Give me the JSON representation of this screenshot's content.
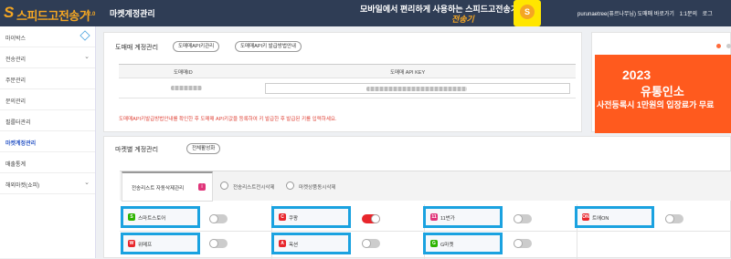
{
  "header": {
    "logo_text": "스피드고전송기",
    "logo_version": "V2.0",
    "page_title": "마켓계정관리",
    "banner_text": "모바일에서 편리하게 사용하는 스피드고전송기!",
    "banner_sub": "전송기",
    "user_links": [
      "purunaetree(퓨르나무님) 도매매 바로가기",
      "1:1문의",
      "로그"
    ]
  },
  "sidebar": {
    "items": [
      {
        "label": "마이박스",
        "has_icon": "cube-icon"
      },
      {
        "label": "전송관리",
        "chevron": "⌄"
      },
      {
        "label": "주문관리"
      },
      {
        "label": "문의관리"
      },
      {
        "label": "필를터관리"
      },
      {
        "label": "마켓계정관리",
        "active": true
      },
      {
        "label": "매출통계"
      },
      {
        "label": "해외마켓(쇼피)",
        "chevron": "⌄"
      }
    ]
  },
  "wholesale": {
    "title": "도매매 계정관리",
    "btn_api_manage": "도매매API키관리",
    "btn_api_guide": "도매매API키 발급방법안내",
    "col_id": "도매매ID",
    "col_key": "도매매 API KEY",
    "warning": "도매매API키발급방법안내를 확인한 후 도매매 API키값을 등록하여 키 발급한 후 발급된 키를 입력하세요."
  },
  "ad": {
    "year": "2023",
    "headline": "유통인소",
    "subline": "사전등록시 1만원의 입장료가 무료",
    "accent": "#ff5a1e"
  },
  "markets": {
    "title": "마켓별 계정관리",
    "btn_activate_all": "전체활성화",
    "tabs": [
      {
        "label": "전송리스트 자동삭제관리",
        "active": true,
        "badge": "i"
      },
      {
        "label": "전송리스트전시삭제"
      },
      {
        "label": "마켓상품동시삭제"
      }
    ],
    "items": [
      {
        "name": "스마트스토어",
        "icon_text": "S",
        "icon_color": "#2db400",
        "enabled": false
      },
      {
        "name": "쿠팡",
        "icon_text": "C",
        "icon_color": "#e8262c",
        "enabled": true
      },
      {
        "name": "11번가",
        "icon_text": "11",
        "icon_color": "#e0357a",
        "enabled": false
      },
      {
        "name": "트에ON",
        "icon_text": "ON",
        "icon_color": "#e8262c",
        "enabled": false
      },
      {
        "name": "위메프",
        "icon_text": "W",
        "icon_color": "#e8262c",
        "enabled": false
      },
      {
        "name": "옥션",
        "icon_text": "A",
        "icon_color": "#e8262c",
        "enabled": false
      },
      {
        "name": "G마켓",
        "icon_text": "G",
        "icon_color": "#2db400",
        "enabled": false
      }
    ]
  }
}
